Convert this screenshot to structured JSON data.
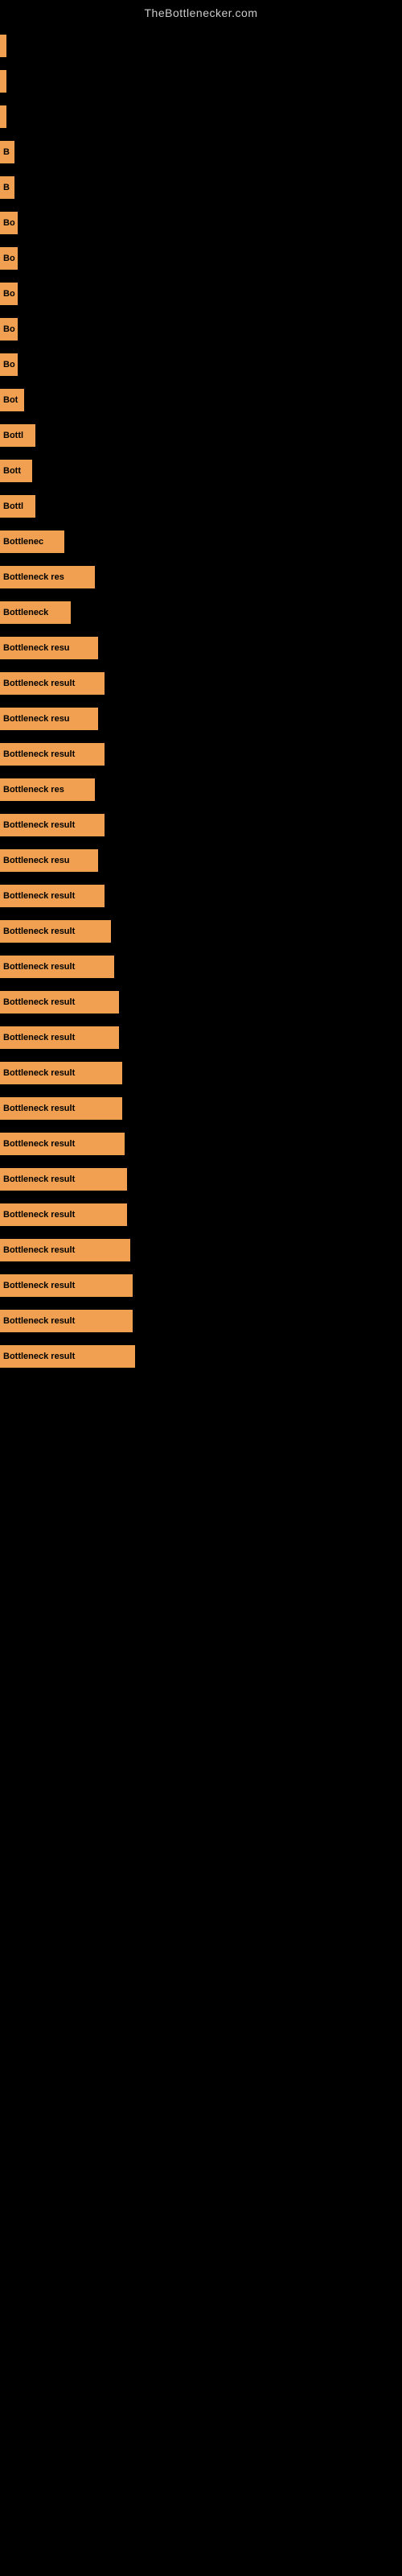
{
  "site": {
    "title": "TheBottlenecker.com"
  },
  "bars": [
    {
      "label": "",
      "width": 8
    },
    {
      "label": "",
      "width": 8
    },
    {
      "label": "",
      "width": 8
    },
    {
      "label": "B",
      "width": 18
    },
    {
      "label": "B",
      "width": 18
    },
    {
      "label": "Bo",
      "width": 22
    },
    {
      "label": "Bo",
      "width": 22
    },
    {
      "label": "Bo",
      "width": 22
    },
    {
      "label": "Bo",
      "width": 22
    },
    {
      "label": "Bo",
      "width": 22
    },
    {
      "label": "Bot",
      "width": 30
    },
    {
      "label": "Bottl",
      "width": 44
    },
    {
      "label": "Bott",
      "width": 40
    },
    {
      "label": "Bottl",
      "width": 44
    },
    {
      "label": "Bottlenec",
      "width": 80
    },
    {
      "label": "Bottleneck res",
      "width": 118
    },
    {
      "label": "Bottleneck",
      "width": 88
    },
    {
      "label": "Bottleneck resu",
      "width": 122
    },
    {
      "label": "Bottleneck result",
      "width": 130
    },
    {
      "label": "Bottleneck resu",
      "width": 122
    },
    {
      "label": "Bottleneck result",
      "width": 130
    },
    {
      "label": "Bottleneck res",
      "width": 118
    },
    {
      "label": "Bottleneck result",
      "width": 130
    },
    {
      "label": "Bottleneck resu",
      "width": 122
    },
    {
      "label": "Bottleneck result",
      "width": 130
    },
    {
      "label": "Bottleneck result",
      "width": 138
    },
    {
      "label": "Bottleneck result",
      "width": 142
    },
    {
      "label": "Bottleneck result",
      "width": 148
    },
    {
      "label": "Bottleneck result",
      "width": 148
    },
    {
      "label": "Bottleneck result",
      "width": 152
    },
    {
      "label": "Bottleneck result",
      "width": 152
    },
    {
      "label": "Bottleneck result",
      "width": 155
    },
    {
      "label": "Bottleneck result",
      "width": 158
    },
    {
      "label": "Bottleneck result",
      "width": 158
    },
    {
      "label": "Bottleneck result",
      "width": 162
    },
    {
      "label": "Bottleneck result",
      "width": 165
    },
    {
      "label": "Bottleneck result",
      "width": 165
    },
    {
      "label": "Bottleneck result",
      "width": 168
    }
  ]
}
